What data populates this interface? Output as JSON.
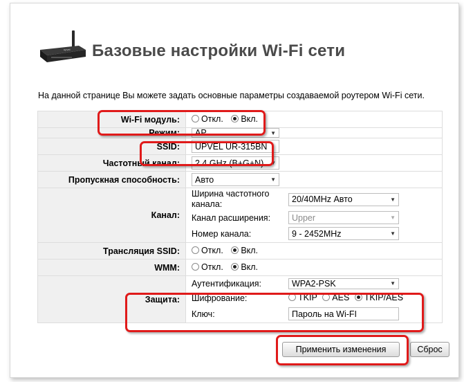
{
  "page": {
    "title": "Базовые настройки Wi-Fi сети",
    "description": "На данной странице Вы можете задать основные параметры создаваемой роутером Wi-Fi сети."
  },
  "wifi_module": {
    "label": "Wi-Fi модуль:",
    "off": "Откл.",
    "on": "Вкл.",
    "selected": "on"
  },
  "mode": {
    "label": "Режим:",
    "value": "AP"
  },
  "ssid": {
    "label": "SSID:",
    "value": "UPVEL UR-315BN"
  },
  "channel_band": {
    "label": "Частотный канал:",
    "value": "2.4 GHz (B+G+N)"
  },
  "bandwidth": {
    "label": "Пропускная способность:",
    "value": "Авто"
  },
  "channel": {
    "label": "Канал:",
    "width_label_line1": "Ширина частотного",
    "width_label_line2": "канала:",
    "width_value": "20/40MHz Авто",
    "extension_label": "Канал расширения:",
    "extension_value": "Upper",
    "number_label": "Номер канала:",
    "number_value": "9 - 2452MHz"
  },
  "ssid_broadcast": {
    "label": "Трансляция SSID:",
    "off": "Откл.",
    "on": "Вкл.",
    "selected": "on"
  },
  "wmm": {
    "label": "WMM:",
    "off": "Откл.",
    "on": "Вкл.",
    "selected": "on"
  },
  "security": {
    "label": "Защита:",
    "auth_label": "Аутентификация:",
    "auth_value": "WPA2-PSK",
    "encryption_label": "Шифрование:",
    "enc_tkip": "TKIP",
    "enc_aes": "AES",
    "enc_both": "TKIP/AES",
    "selected": "TKIP/AES",
    "key_label": "Ключ:",
    "key_value": "Пароль на Wi-FI"
  },
  "buttons": {
    "apply": "Применить изменения",
    "reset": "Сброс"
  },
  "colors": {
    "highlight": "#e01a1a",
    "label_bg": "#f0f0f0",
    "title": "#4a4a4a"
  }
}
